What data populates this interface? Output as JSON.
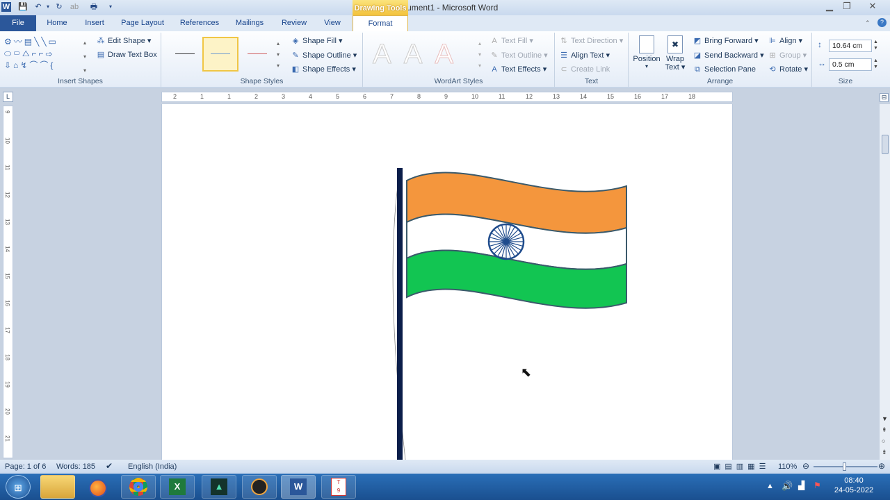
{
  "window": {
    "title": "Document1  -  Microsoft Word",
    "contextual_tab": "Drawing Tools"
  },
  "tabs": [
    "File",
    "Home",
    "Insert",
    "Page Layout",
    "References",
    "Mailings",
    "Review",
    "View",
    "Format"
  ],
  "ribbon": {
    "insert_shapes": {
      "label": "Insert Shapes",
      "edit_shape": "Edit Shape",
      "draw_text_box": "Draw Text Box"
    },
    "shape_styles": {
      "label": "Shape Styles",
      "fill": "Shape Fill",
      "outline": "Shape Outline",
      "effects": "Shape Effects"
    },
    "wordart_styles": {
      "label": "WordArt Styles",
      "text_fill": "Text Fill",
      "text_outline": "Text Outline",
      "text_effects": "Text Effects",
      "sample": "A"
    },
    "text": {
      "label": "Text",
      "direction": "Text Direction",
      "align": "Align Text",
      "create_link": "Create Link"
    },
    "arrange": {
      "label": "Arrange",
      "position": "Position",
      "wrap_text_1": "Wrap",
      "wrap_text_2": "Text",
      "bring_forward": "Bring Forward",
      "send_backward": "Send Backward",
      "selection_pane": "Selection Pane",
      "align": "Align",
      "group": "Group",
      "rotate": "Rotate"
    },
    "size": {
      "label": "Size",
      "height": "10.64 cm",
      "width": "0.5 cm"
    }
  },
  "ruler_numbers": [
    "2",
    "1",
    "1",
    "2",
    "3",
    "4",
    "5",
    "6",
    "7",
    "8",
    "9",
    "10",
    "11",
    "12",
    "13",
    "14",
    "15",
    "16",
    "17",
    "18"
  ],
  "vruler_numbers": [
    "9",
    "10",
    "11",
    "12",
    "13",
    "14",
    "15",
    "16",
    "17",
    "18",
    "19",
    "20",
    "21"
  ],
  "status": {
    "page": "Page: 1 of 6",
    "words": "Words: 185",
    "language": "English (India)",
    "zoom": "110%"
  },
  "clock": {
    "time": "08:40",
    "date": "24-05-2022"
  },
  "colors": {
    "saffron": "#F4963D",
    "green": "#12C552",
    "chakra": "#1E4B8C",
    "pole": "#0B1E4A",
    "outline": "#3B5A6B"
  }
}
